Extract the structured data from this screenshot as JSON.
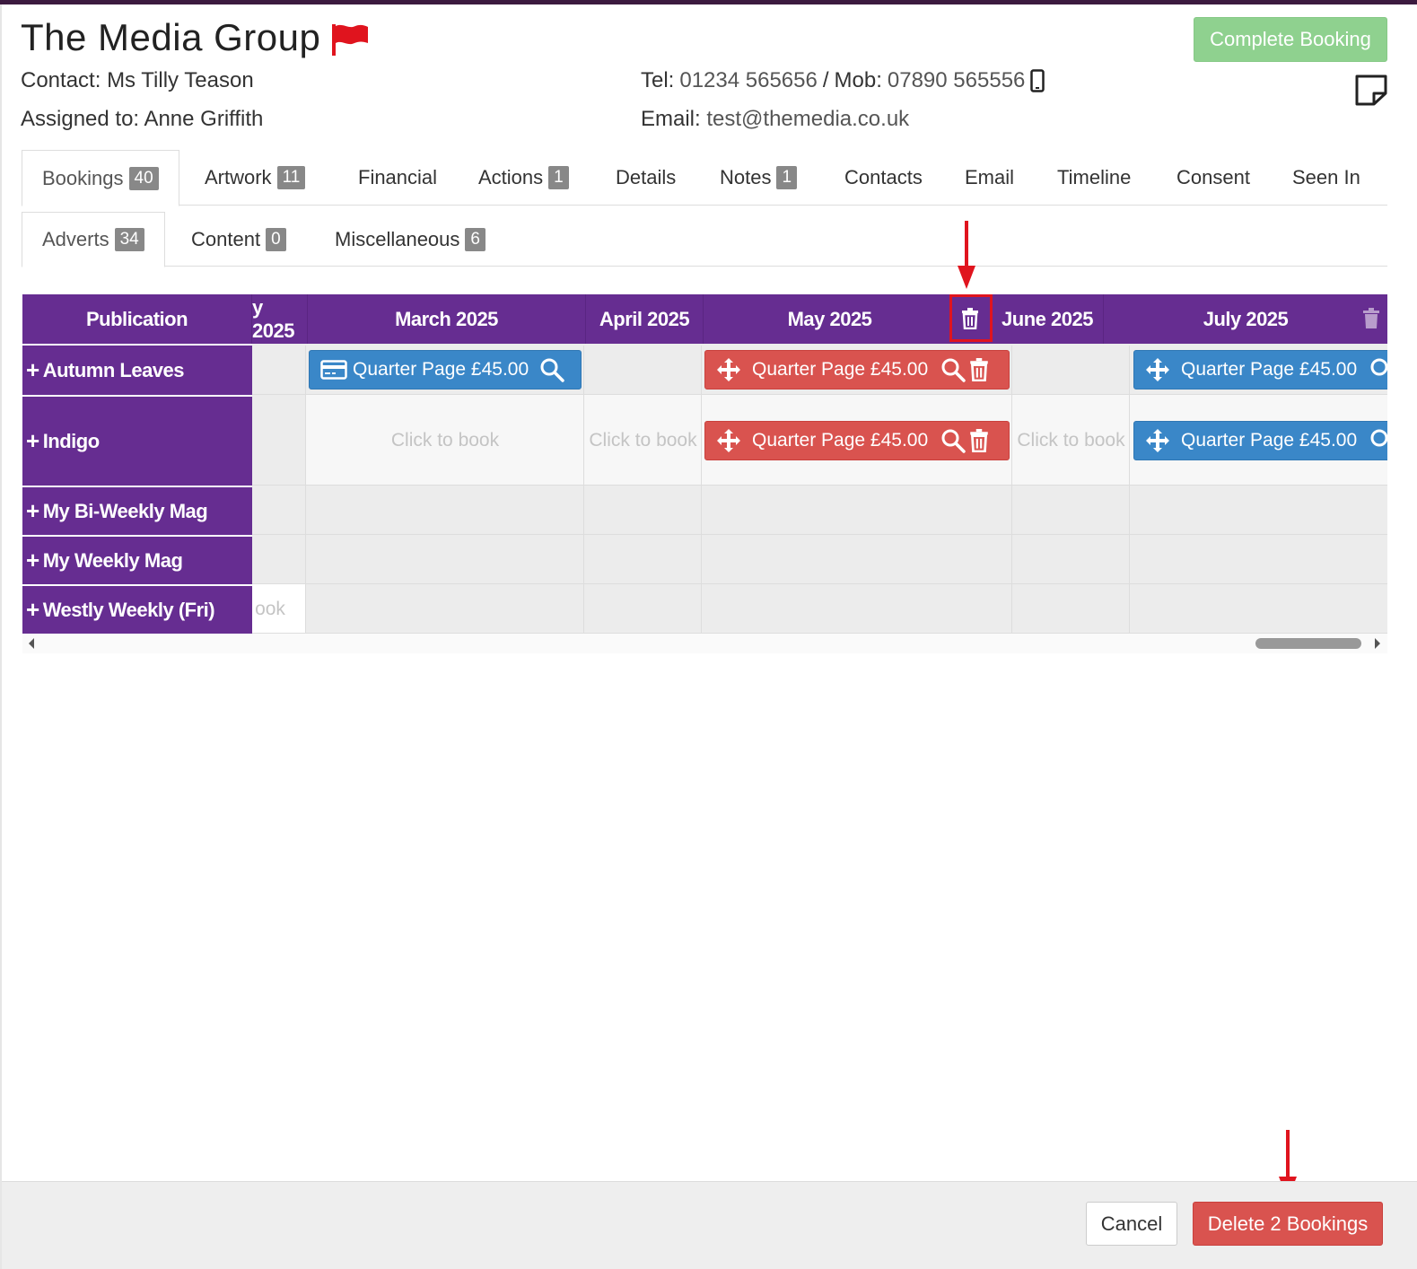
{
  "header": {
    "company": "The Media Group",
    "contact_label": "Contact:",
    "contact_value": "Ms Tilly Teason",
    "assigned_label": "Assigned to:",
    "assigned_value": "Anne Griffith",
    "tel_label": "Tel:",
    "tel_value": "01234 565656",
    "separator": "/",
    "mob_label": "Mob:",
    "mob_value": "07890 565556",
    "email_label": "Email:",
    "email_value": "test@themedia.co.uk",
    "complete_label": "Complete Booking",
    "icons": {
      "flag": "flag-icon",
      "mobile": "mobile-phone-icon",
      "note": "sticky-note-icon"
    },
    "flag_color": "#e0141e"
  },
  "tabs": [
    {
      "label": "Bookings",
      "badge": "40"
    },
    {
      "label": "Artwork",
      "badge": "11"
    },
    {
      "label": "Financial"
    },
    {
      "label": "Actions",
      "badge": "1"
    },
    {
      "label": "Details"
    },
    {
      "label": "Notes",
      "badge": "1"
    },
    {
      "label": "Contacts"
    },
    {
      "label": "Email"
    },
    {
      "label": "Timeline"
    },
    {
      "label": "Consent"
    },
    {
      "label": "Seen In"
    }
  ],
  "subtabs": [
    {
      "label": "Adverts",
      "badge": "34"
    },
    {
      "label": "Content",
      "badge": "0"
    },
    {
      "label": "Miscellaneous",
      "badge": "6"
    }
  ],
  "grid": {
    "publication_header": "Publication",
    "months": [
      "y 2025",
      "March 2025",
      "April 2025",
      "May 2025",
      "June 2025",
      "July 2025"
    ],
    "publications": [
      "Autumn Leaves",
      "Indigo",
      "My Bi-Weekly Mag",
      "My Weekly Mag",
      "Westly Weekly (Fri)"
    ],
    "click_to_book": "Click to book",
    "click_to_book_partial": "ook",
    "booking_label": "Quarter Page £45.00",
    "colors": {
      "header": "#662d91",
      "booked_blue": "#3a87c8",
      "selected_red": "#d9534f"
    }
  },
  "footer": {
    "cancel_label": "Cancel",
    "delete_label": "Delete 2 Bookings"
  }
}
